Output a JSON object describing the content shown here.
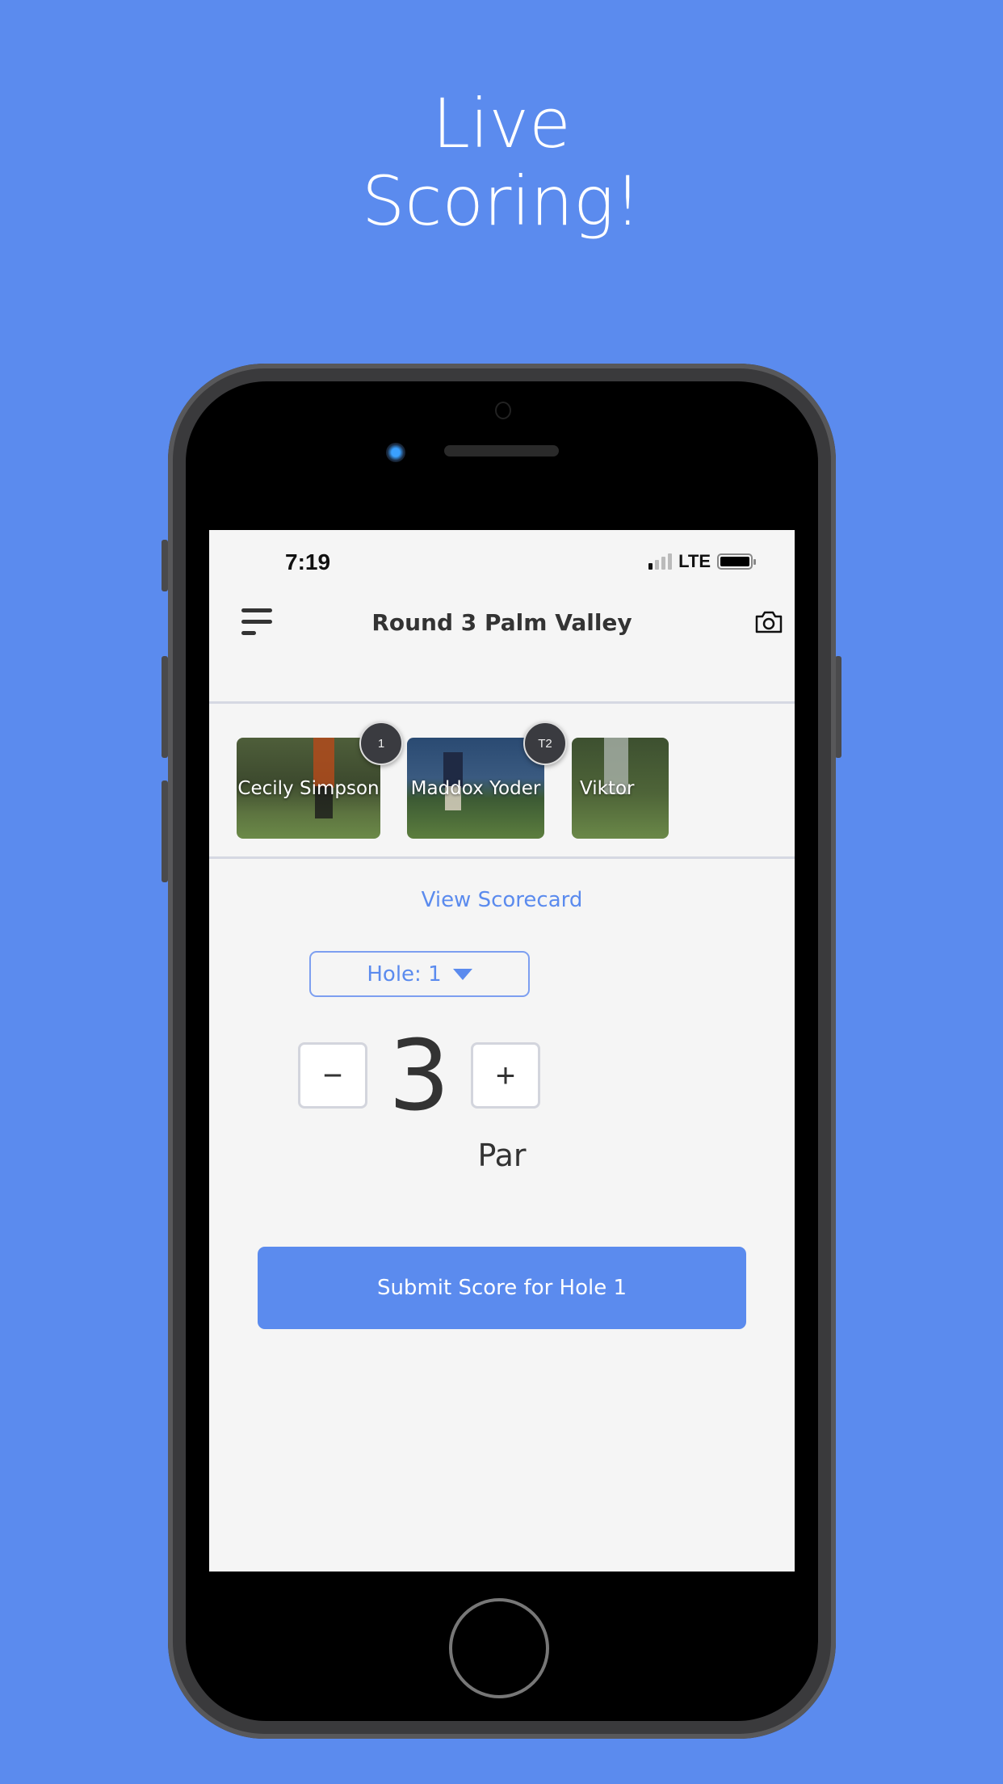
{
  "headline": {
    "line1": "Live",
    "line2": "Scoring!"
  },
  "colors": {
    "background": "#5b8bee",
    "accent": "#5b8bee",
    "text": "#333333"
  },
  "status_bar": {
    "time": "7:19",
    "network": "LTE"
  },
  "header": {
    "title": "Round 3 Palm Valley",
    "menu_icon": "menu-icon",
    "camera_icon": "camera-icon"
  },
  "players": [
    {
      "name": "Cecily Simpson",
      "rank": "1"
    },
    {
      "name": "Maddox Yoder",
      "rank": "T2"
    },
    {
      "name": "Viktor"
    }
  ],
  "main": {
    "view_scorecard": "View Scorecard",
    "hole_select": "Hole: 1",
    "minus": "−",
    "plus": "+",
    "score": "3",
    "score_label": "Par",
    "submit": "Submit Score for Hole 1"
  }
}
